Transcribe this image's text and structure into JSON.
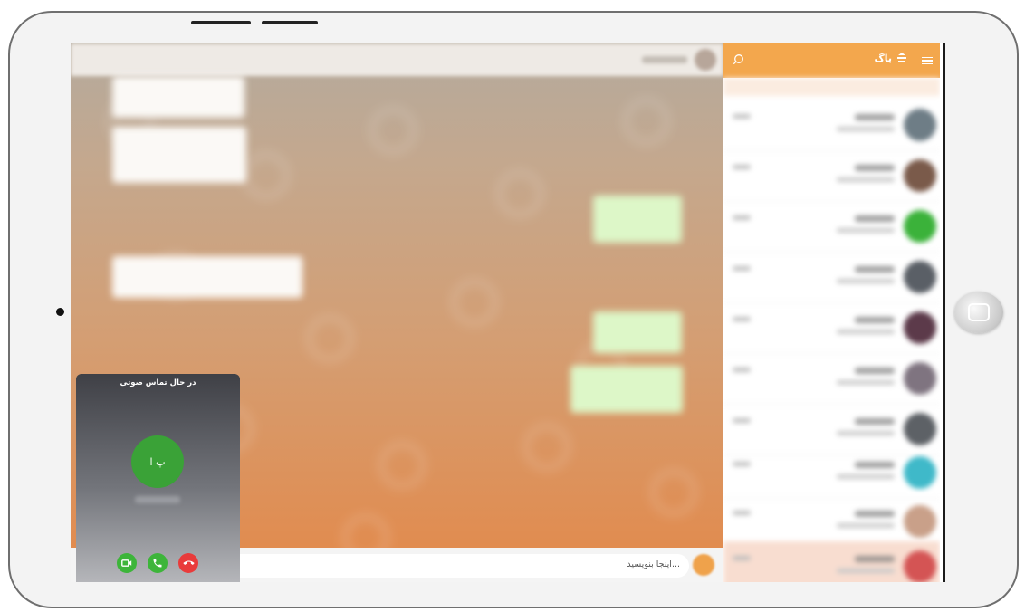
{
  "app": {
    "brand_name": "باگ",
    "brand_color": "#f3a74d"
  },
  "sidebar": {
    "search_icon": "search-icon",
    "menu_icon": "hamburger-menu-icon",
    "conversations": [
      {
        "avatar_color": "#6e7d86"
      },
      {
        "avatar_color": "#7a5a4a"
      },
      {
        "avatar_color": "#3bb23a"
      },
      {
        "avatar_color": "#5a5f66"
      },
      {
        "avatar_color": "#5c3a4a"
      },
      {
        "avatar_color": "#7f7480"
      },
      {
        "avatar_color": "#5d6166"
      },
      {
        "avatar_color": "#3fb9c9"
      },
      {
        "avatar_color": "#c9a089"
      },
      {
        "avatar_color": "#d45454"
      }
    ]
  },
  "composer": {
    "placeholder": "اینجا بنویسید..."
  },
  "call": {
    "title": "در حال تماس صوتی",
    "avatar_initials": "پ ا",
    "avatar_color": "#3aa237",
    "buttons": [
      {
        "name": "video-call-button",
        "icon": "video-camera-icon",
        "color": "#3db53a"
      },
      {
        "name": "voice-call-button",
        "icon": "phone-icon",
        "color": "#3db53a"
      },
      {
        "name": "end-call-button",
        "icon": "phone-hangup-icon",
        "color": "#e93b3b"
      }
    ]
  }
}
